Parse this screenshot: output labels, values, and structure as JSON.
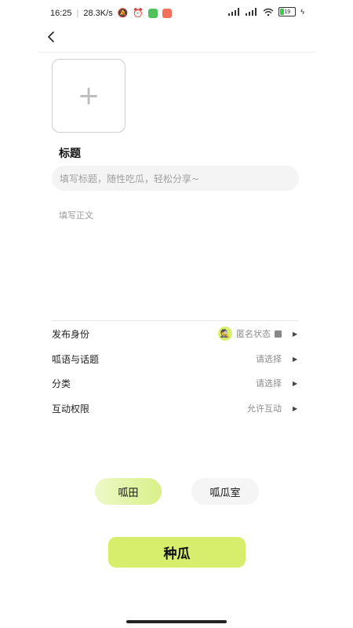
{
  "status": {
    "time": "16:25",
    "speed": "28.3K/s",
    "battery": "19"
  },
  "header": {
    "back_icon": "chevron-left-icon"
  },
  "upload": {
    "icon": "plus-icon"
  },
  "form": {
    "title_label": "标题",
    "title_placeholder": "填写标题，随性吃瓜，轻松分享~",
    "body_placeholder": "填写正文"
  },
  "settings": {
    "identity": {
      "label": "发布身份",
      "value": "匿名状态"
    },
    "topic": {
      "label": "呱语与话题",
      "value": "请选择"
    },
    "category": {
      "label": "分类",
      "value": "请选择"
    },
    "permission": {
      "label": "互动权限",
      "value": "允许互动"
    }
  },
  "tabs": {
    "field": "呱田",
    "room": "呱瓜室"
  },
  "submit": {
    "label": "种瓜"
  },
  "colors": {
    "accent": "#d7ee6c",
    "input_bg": "#f4f4f4"
  }
}
